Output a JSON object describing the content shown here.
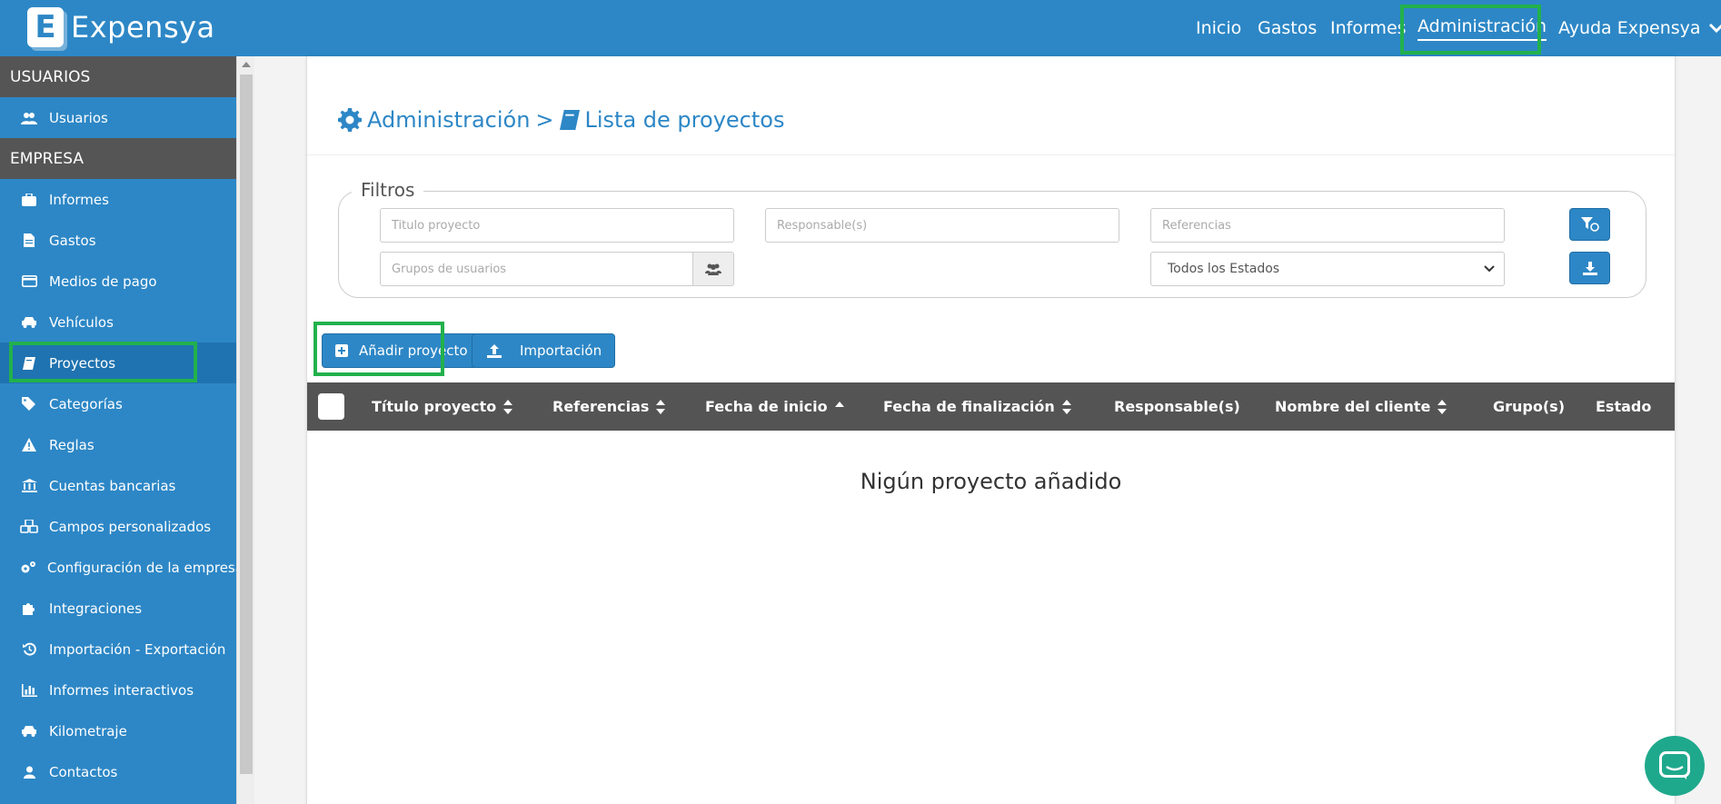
{
  "app": {
    "logo_letter": "E",
    "name": "Expensya"
  },
  "nav": {
    "inicio": "Inicio",
    "gastos": "Gastos",
    "informes": "Informes",
    "administracion": "Administración",
    "ayuda": "Ayuda Expensya"
  },
  "sidebar": {
    "section_users": "USUARIOS",
    "usuarios": "Usuarios",
    "section_company": "EMPRESA",
    "items": [
      {
        "label": "Informes",
        "icon": "briefcase-icon"
      },
      {
        "label": "Gastos",
        "icon": "file-icon"
      },
      {
        "label": "Medios de pago",
        "icon": "credit-card-icon"
      },
      {
        "label": "Vehículos",
        "icon": "car-icon"
      },
      {
        "label": "Proyectos",
        "icon": "book-icon"
      },
      {
        "label": "Categorías",
        "icon": "tags-icon"
      },
      {
        "label": "Reglas",
        "icon": "warning-icon"
      },
      {
        "label": "Cuentas bancarias",
        "icon": "bank-icon"
      },
      {
        "label": "Campos personalizados",
        "icon": "cubes-icon"
      },
      {
        "label": "Configuración de la empresa",
        "icon": "cogs-icon"
      },
      {
        "label": "Integraciones",
        "icon": "puzzle-icon"
      },
      {
        "label": "Importación - Exportación",
        "icon": "history-icon"
      },
      {
        "label": "Informes interactivos",
        "icon": "bar-chart-icon"
      },
      {
        "label": "Kilometraje",
        "icon": "car-icon"
      },
      {
        "label": "Contactos",
        "icon": "user-icon"
      }
    ]
  },
  "breadcrumb": {
    "admin": "Administración",
    "separator": ">",
    "page": "Lista de proyectos"
  },
  "filters": {
    "legend": "Filtros",
    "titulo_placeholder": "Titulo proyecto",
    "responsable_placeholder": "Responsable(s)",
    "referencias_placeholder": "Referencias",
    "grupos_placeholder": "Grupos de usuarios",
    "estado_selected": "Todos los Estados"
  },
  "actions": {
    "add": "Añadir proyecto",
    "import": "Importación"
  },
  "table": {
    "columns": [
      "Título proyecto",
      "Referencias",
      "Fecha de inicio",
      "Fecha de finalización",
      "Responsable(s)",
      "Nombre del cliente",
      "Grupo(s)",
      "Estado"
    ],
    "empty": "Nigún proyecto añadido"
  },
  "colors": {
    "brand": "#2d87c6",
    "highlight": "#22b14c",
    "table_header": "#545454",
    "chat": "#1fa98c"
  }
}
